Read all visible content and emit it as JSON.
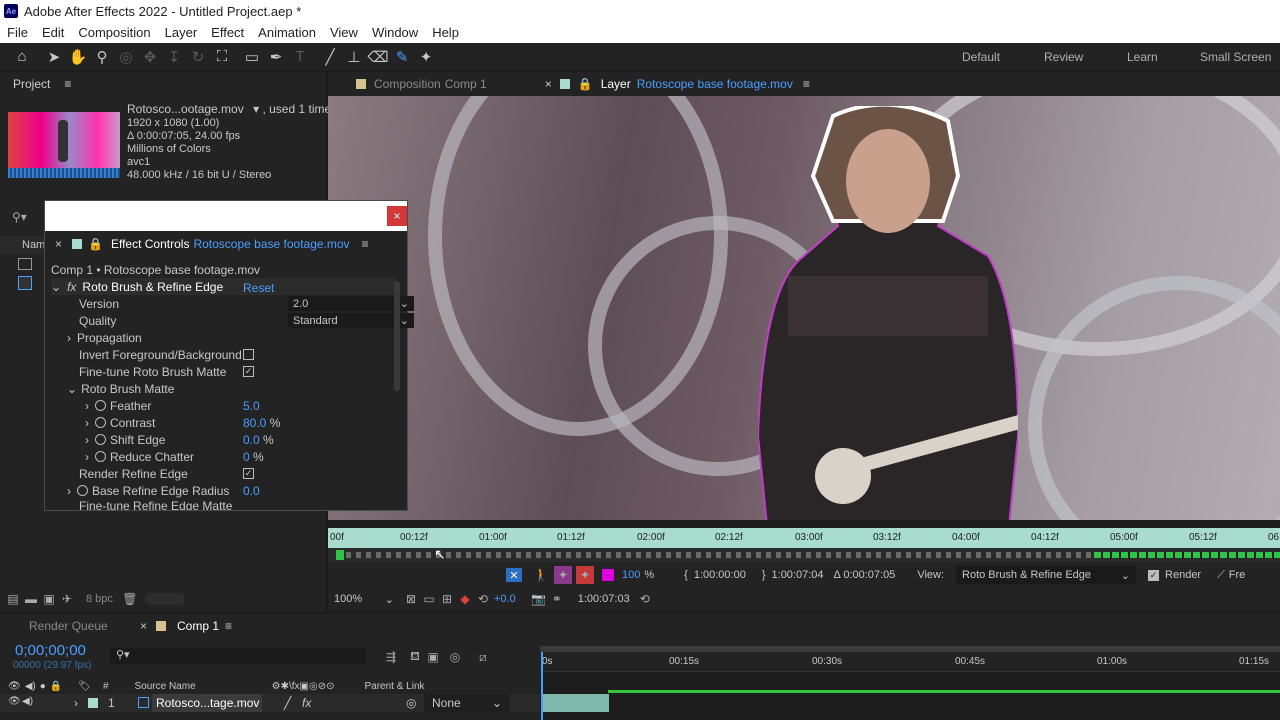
{
  "window": {
    "title": "Adobe After Effects 2022 - Untitled Project.aep *",
    "logo": "Ae"
  },
  "menu": [
    "File",
    "Edit",
    "Composition",
    "Layer",
    "Effect",
    "Animation",
    "View",
    "Window",
    "Help"
  ],
  "workspaces": [
    "Default",
    "Review",
    "Learn",
    "Small Screen"
  ],
  "project": {
    "panel_title": "Project",
    "file_name": "Rotosco...ootage.mov",
    "used": ", used 1 time",
    "info": [
      "1920 x 1080 (1.00)",
      "Δ 0:00:07:05, 24.00 fps",
      "Millions of Colors",
      "avc1",
      "48.000 kHz / 16 bit U / Stereo"
    ],
    "col_name": "Nam",
    "bpc": "8 bpc"
  },
  "tabs": {
    "comp_tab": "Composition",
    "comp_name": "Comp 1",
    "layer_tab": "Layer",
    "layer_name": "Rotoscope base footage.mov"
  },
  "effect_controls": {
    "title": "Effect Controls",
    "file": "Rotoscope base footage.mov",
    "breadcrumb": "Comp 1 • Rotoscope base footage.mov",
    "effect_name": "Roto Brush & Refine Edge",
    "reset": "Reset",
    "version_label": "Version",
    "version_value": "2.0",
    "quality_label": "Quality",
    "quality_value": "Standard",
    "propagation": "Propagation",
    "invert": "Invert Foreground/Background",
    "finetune": "Fine-tune Roto Brush Matte",
    "matte": "Roto Brush Matte",
    "feather_label": "Feather",
    "feather_value": "5.0",
    "contrast_label": "Contrast",
    "contrast_value": "80.0",
    "contrast_unit": "%",
    "shift_label": "Shift Edge",
    "shift_value": "0.0",
    "shift_unit": "%",
    "chatter_label": "Reduce Chatter",
    "chatter_value": "0",
    "chatter_unit": "%",
    "render_refine": "Render Refine Edge",
    "base_radius_label": "Base Refine Edge Radius",
    "base_radius_value": "0.0",
    "finetune_refine": "Fine-tune Refine Edge Matte"
  },
  "ruler": [
    "00f",
    "00:12f",
    "01:00f",
    "01:12f",
    "02:00f",
    "02:12f",
    "03:00f",
    "03:12f",
    "04:00f",
    "04:12f",
    "05:00f",
    "05:12f",
    "06"
  ],
  "viewer_controls": {
    "zoom_pct": "100",
    "pct": "%",
    "in": "1:00:00:00",
    "out": "1:00:07:04",
    "duration": "Δ 0:00:07:05",
    "view_label": "View:",
    "view_value": "Roto Brush & Refine Edge",
    "render": "Render",
    "fre": "Fre",
    "magnify": "100%",
    "exposure": "+0.0",
    "time": "1:00:07:03"
  },
  "timeline": {
    "render_queue": "Render Queue",
    "comp": "Comp 1",
    "timecode": "0;00;00;00",
    "frame": "00000 (29.97 fps)",
    "col_num": "#",
    "col_source": "Source Name",
    "col_parent": "Parent & Link",
    "layer_num": "1",
    "layer_name": "Rotosco...tage.mov",
    "parent": "None",
    "ticks": [
      "0s",
      "00:15s",
      "00:30s",
      "00:45s",
      "01:00s",
      "01:15s"
    ]
  }
}
